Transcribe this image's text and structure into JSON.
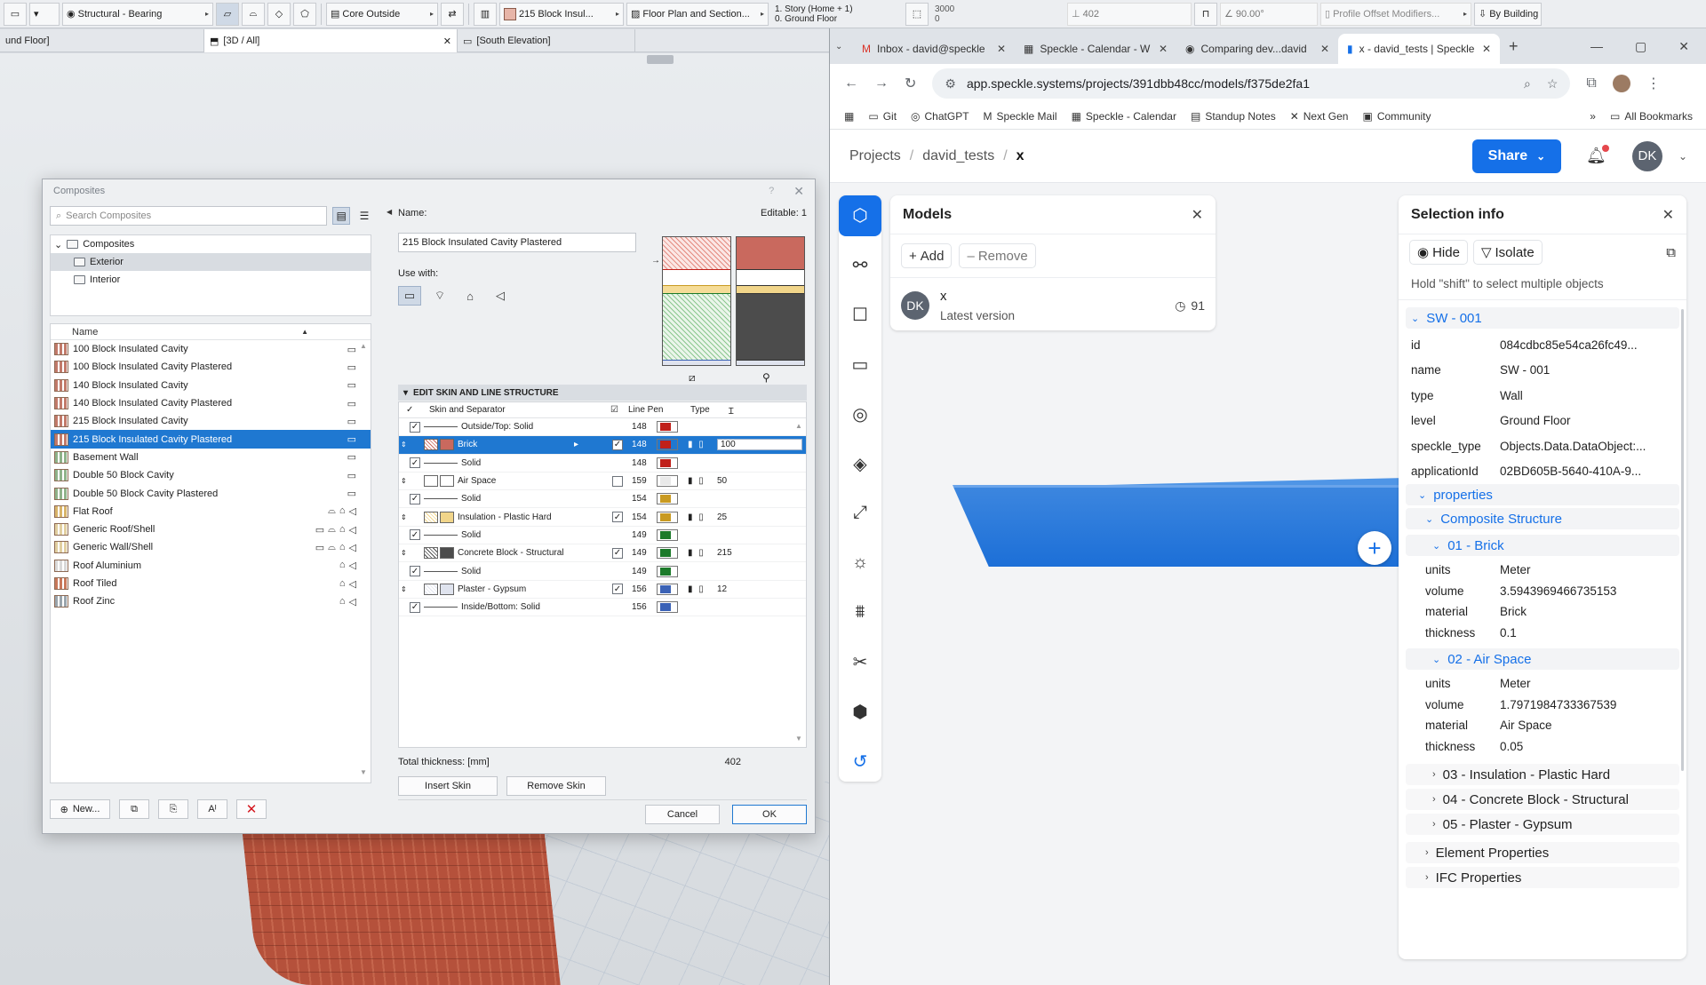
{
  "archicad": {
    "toolbar": [
      {
        "label": "Structural - Bearing"
      },
      {
        "label": "Core Outside"
      },
      {
        "label": "215 Block Insul..."
      },
      {
        "label": "Floor Plan and Section..."
      },
      {
        "label": "1. Story (Home + 1)"
      },
      {
        "label": "0. Ground Floor"
      },
      {
        "label": "3000"
      },
      {
        "label": "0"
      },
      {
        "label": "402"
      },
      {
        "label": "90.00°"
      },
      {
        "label": "Profile Offset Modifiers..."
      },
      {
        "label": "By Building"
      }
    ],
    "view_tabs": [
      {
        "label": "und Floor]"
      },
      {
        "label": "[3D / All]"
      },
      {
        "label": "[South Elevation]"
      }
    ]
  },
  "dialog": {
    "title": "Composites",
    "help": "?",
    "search_placeholder": "Search Composites",
    "tree": {
      "root": "Composites",
      "children": [
        "Exterior",
        "Interior"
      ]
    },
    "list_header": "Name",
    "list": [
      {
        "name": "100 Block Insulated Cavity",
        "color": "#c27a6a"
      },
      {
        "name": "100 Block Insulated Cavity Plastered",
        "color": "#c27a6a"
      },
      {
        "name": "140 Block Insulated Cavity",
        "color": "#c27a6a"
      },
      {
        "name": "140 Block Insulated Cavity Plastered",
        "color": "#c27a6a"
      },
      {
        "name": "215 Block Insulated Cavity",
        "color": "#c27a6a"
      },
      {
        "name": "215 Block Insulated Cavity Plastered",
        "color": "#c27a6a"
      },
      {
        "name": "Basement Wall",
        "color": "#8fb38a"
      },
      {
        "name": "Double 50 Block Cavity",
        "color": "#8fb38a"
      },
      {
        "name": "Double 50 Block Cavity Plastered",
        "color": "#8fb38a"
      },
      {
        "name": "Flat Roof",
        "color": "#d8b46a"
      },
      {
        "name": "Generic Roof/Shell",
        "color": "#e1cfa0"
      },
      {
        "name": "Generic Wall/Shell",
        "color": "#e1cfa0"
      },
      {
        "name": "Roof Aluminium",
        "color": "#d9d9d9"
      },
      {
        "name": "Roof Tiled",
        "color": "#c8785a"
      },
      {
        "name": "Roof Zinc",
        "color": "#9aa5ad"
      }
    ],
    "name_label": "Name:",
    "editable": "Editable: 1",
    "name_value": "215 Block Insulated Cavity Plastered",
    "use_with": "Use with:",
    "section_title": "EDIT SKIN AND LINE STRUCTURE",
    "cols": {
      "skin": "Skin and Separator",
      "pen": "Line Pen",
      "type": "Type"
    },
    "skins": [
      {
        "kind": "sep",
        "name": "Outside/Top: Solid",
        "pen": "148",
        "pc": "#c0201a"
      },
      {
        "kind": "skin",
        "name": "Brick",
        "pen": "148",
        "pc": "#c0201a",
        "fc": "#c9695e",
        "th": "100",
        "sel": true
      },
      {
        "kind": "sep",
        "name": "Solid",
        "pen": "148",
        "pc": "#c0201a"
      },
      {
        "kind": "skin",
        "name": "Air Space",
        "pen": "159",
        "pc": "#e9e9e9",
        "fc": "#ffffff",
        "th": "50"
      },
      {
        "kind": "sep",
        "name": "Solid",
        "pen": "154",
        "pc": "#c99a21"
      },
      {
        "kind": "skin",
        "name": "Insulation - Plastic Hard",
        "pen": "154",
        "pc": "#c99a21",
        "fc": "#f1d58a",
        "th": "25"
      },
      {
        "kind": "sep",
        "name": "Solid",
        "pen": "149",
        "pc": "#1c7a2a"
      },
      {
        "kind": "skin",
        "name": "Concrete Block - Structural",
        "pen": "149",
        "pc": "#1c7a2a",
        "fc": "#4c4c4c",
        "th": "215"
      },
      {
        "kind": "sep",
        "name": "Solid",
        "pen": "149",
        "pc": "#1c7a2a"
      },
      {
        "kind": "skin",
        "name": "Plaster - Gypsum",
        "pen": "156",
        "pc": "#3b62b6",
        "fc": "#dfe3ee",
        "th": "12"
      },
      {
        "kind": "sep",
        "name": "Inside/Bottom: Solid",
        "pen": "156",
        "pc": "#3b62b6"
      }
    ],
    "total_label": "Total thickness: [mm]",
    "total": "402",
    "insert": "Insert Skin",
    "remove": "Remove Skin",
    "new": "New...",
    "cancel": "Cancel",
    "ok": "OK"
  },
  "browser": {
    "tabs": [
      {
        "label": "Inbox - david@speckle",
        "icon": "M"
      },
      {
        "label": "Speckle - Calendar - W",
        "icon": "▦"
      },
      {
        "label": "Comparing dev...david",
        "icon": "◉"
      },
      {
        "label": "x - david_tests | Speckle",
        "icon": "▮"
      }
    ],
    "url": "app.speckle.systems/projects/391dbb48cc/models/f375de2fa1",
    "bookmarks": [
      "Git",
      "ChatGPT",
      "Speckle Mail",
      "Speckle - Calendar",
      "Standup Notes",
      "Next Gen",
      "Community"
    ],
    "all_bookmarks": "All Bookmarks"
  },
  "speckle": {
    "crumbs": [
      "Projects",
      "david_tests",
      "x"
    ],
    "share": "Share",
    "avatar": "DK",
    "models": {
      "title": "Models",
      "add": "Add",
      "remove": "Remove",
      "model_name": "x",
      "model_sub": "Latest version",
      "versions": "91"
    },
    "selection": {
      "title": "Selection info",
      "hide": "Hide",
      "isolate": "Isolate",
      "hint": "Hold \"shift\" to select multiple objects",
      "object": "SW - 001",
      "props": [
        {
          "k": "id",
          "v": "084cdbc85e54ca26fc49..."
        },
        {
          "k": "name",
          "v": "SW - 001"
        },
        {
          "k": "type",
          "v": "Wall"
        },
        {
          "k": "level",
          "v": "Ground Floor"
        },
        {
          "k": "speckle_type",
          "v": "Objects.Data.DataObject:..."
        },
        {
          "k": "applicationId",
          "v": "02BD605B-5640-410A-9..."
        }
      ],
      "properties": "properties",
      "composite": "Composite Structure",
      "layers": [
        {
          "title": "01 - Brick",
          "rows": [
            {
              "k": "units",
              "v": "Meter"
            },
            {
              "k": "volume",
              "v": "3.5943969466735153"
            },
            {
              "k": "material",
              "v": "Brick"
            },
            {
              "k": "thickness",
              "v": "0.1"
            }
          ]
        },
        {
          "title": "02 - Air Space",
          "rows": [
            {
              "k": "units",
              "v": "Meter"
            },
            {
              "k": "volume",
              "v": "1.7971984733367539"
            },
            {
              "k": "material",
              "v": "Air Space"
            },
            {
              "k": "thickness",
              "v": "0.05"
            }
          ]
        }
      ],
      "collapsed_layers": [
        "03 - Insulation - Plastic Hard",
        "04 - Concrete Block - Structural",
        "05 - Plaster - Gypsum"
      ],
      "element_props": "Element Properties",
      "ifc_props": "IFC Properties"
    }
  }
}
